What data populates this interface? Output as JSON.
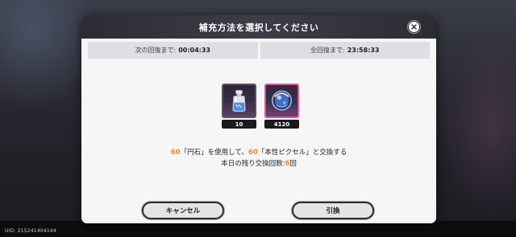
{
  "dialog": {
    "title": "補充方法を選択してください",
    "close_icon": "close-icon"
  },
  "timers": {
    "next_label": "次の回復まで:",
    "next_value": "00:04:33",
    "full_label": "全回復まで:",
    "full_value": "23:58:33"
  },
  "items": [
    {
      "name": "円石",
      "icon": "potion-bottle-icon",
      "count": "10"
    },
    {
      "name": "本性ピクセル",
      "icon": "blue-orb-icon",
      "count": "4120"
    }
  ],
  "message": {
    "line1_amount1": "60",
    "line1_part1": "「円石」を使用して、",
    "line1_amount2": "60",
    "line1_part2": "「本性ピクセル」と交換する",
    "line2_label": "本日の残り交換回数:",
    "line2_value": "6",
    "line2_suffix": "回"
  },
  "buttons": {
    "cancel": "キャンセル",
    "exchange": "引換"
  },
  "footer": {
    "uid": "UID: 215241404144"
  },
  "colors": {
    "highlight": "#f08a28",
    "header_bg": "#2b2c33",
    "modal_bg": "#f6f6f7",
    "selected_border": "#d8589a"
  }
}
